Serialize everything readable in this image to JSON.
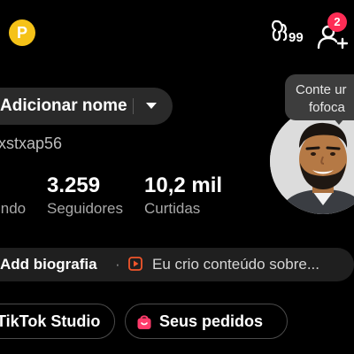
{
  "header": {
    "coin_icon_letter": "P",
    "friends_icon_count": "99",
    "add_friend_badge": "2"
  },
  "profile": {
    "name_button_label": "Adicionar nome",
    "username": "xstxap56",
    "tooltip_line1": "Conte ur",
    "tooltip_line2": "fofoca",
    "stats": [
      {
        "value": "",
        "label": "indo"
      },
      {
        "value": "3.259",
        "label": "Seguidores"
      },
      {
        "value": "10,2 mil",
        "label": "Curtidas"
      }
    ]
  },
  "bio": {
    "add_label": "Add biografia",
    "separator": "·",
    "suggestion": "Eu crio conteúdo sobre..."
  },
  "buttons": {
    "studio_label": "TikTok Studio",
    "orders_label": "Seus pedidos"
  },
  "colors": {
    "background": "#000000",
    "coin": "#f5c218",
    "badge": "#fe2c55",
    "bio_play_icon": "#f0552b",
    "orders_bag_icon": "#ff3b6b"
  }
}
